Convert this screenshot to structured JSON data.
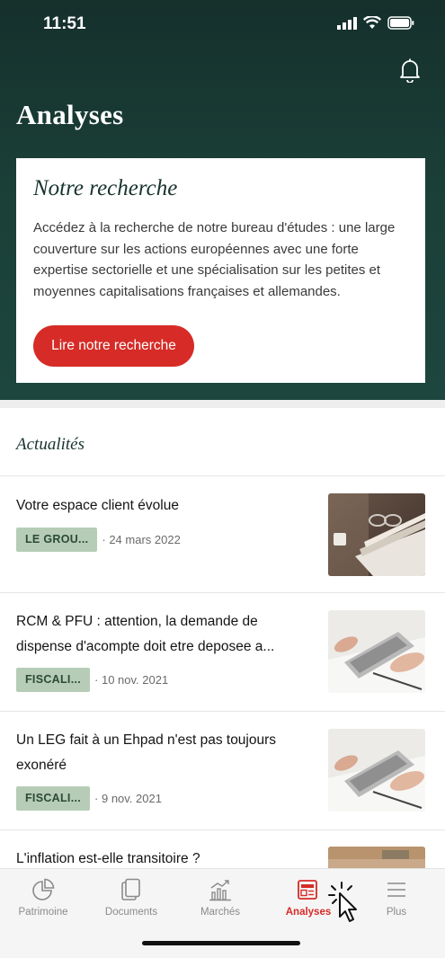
{
  "status_bar": {
    "time": "11:51"
  },
  "header": {
    "title": "Analyses"
  },
  "research": {
    "title": "Notre recherche",
    "text": "Accédez à la recherche de notre bureau d'études : une large couverture sur les actions européennes avec une forte expertise sectorielle et une spécialisation sur les petites et moyennes capitalisations françaises et allemandes.",
    "button_label": "Lire notre recherche"
  },
  "news": {
    "section_title": "Actualités",
    "items": [
      {
        "title": "Votre espace client évolue",
        "tag": "LE GROU...",
        "date": "· 24 mars 2022",
        "image_icon": "documents-stack-photo"
      },
      {
        "title": "RCM & PFU : attention, la demande de dispense d'acompte doit etre deposee a...",
        "tag": "FISCALI...",
        "date": "· 10 nov. 2021",
        "image_icon": "calculator-photo"
      },
      {
        "title": "Un LEG fait à un Ehpad n'est pas toujours exonéré",
        "tag": "FISCALI...",
        "date": "· 9 nov. 2021",
        "image_icon": "calculator-photo"
      },
      {
        "title": "L'inflation est-elle transitoire ?",
        "image_icon": "office-photo"
      }
    ]
  },
  "tabbar": {
    "tabs": [
      {
        "label": "Patrimoine",
        "icon": "pie-chart-icon",
        "active": false
      },
      {
        "label": "Documents",
        "icon": "documents-icon",
        "active": false
      },
      {
        "label": "Marchés",
        "icon": "market-chart-icon",
        "active": false
      },
      {
        "label": "Analyses",
        "icon": "newspaper-icon",
        "active": true
      },
      {
        "label": "Plus",
        "icon": "menu-icon",
        "active": false
      }
    ]
  },
  "colors": {
    "hero": "#1a3f37",
    "accent": "#d62b26",
    "tag_bg": "#b6ccb6",
    "tag_text": "#2a4a36"
  }
}
